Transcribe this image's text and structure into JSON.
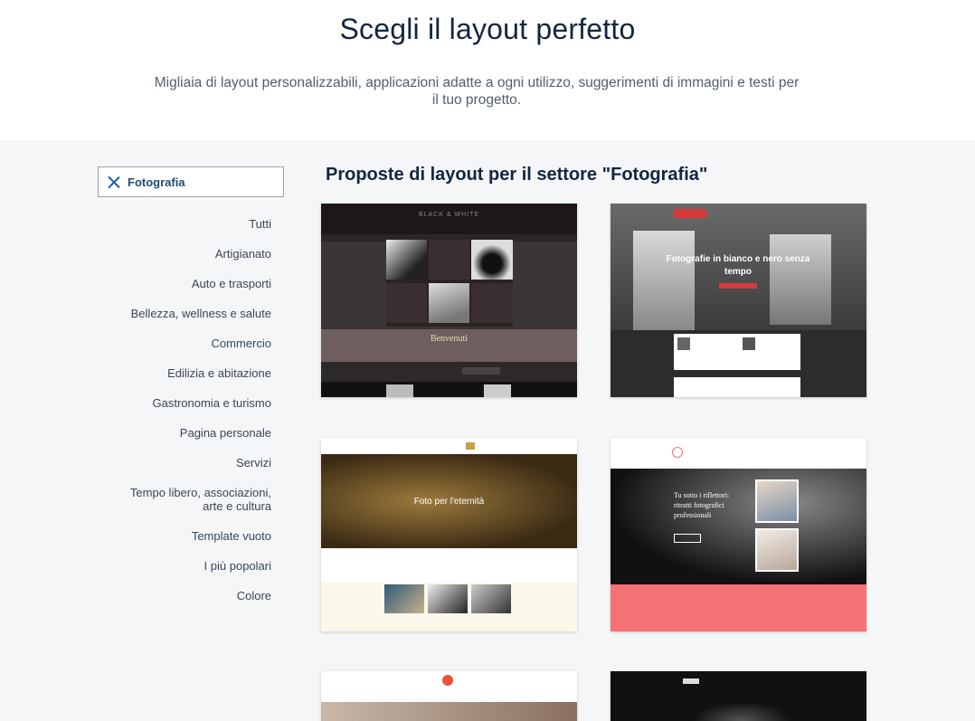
{
  "hero": {
    "title": "Scegli il layout perfetto",
    "subtitle": "Migliaia di layout personalizzabili, applicazioni adatte a ogni utilizzo, suggerimenti di immagini e testi per il tuo progetto."
  },
  "filter": {
    "active_label": "Fotografia",
    "clear_icon": "close-icon"
  },
  "sidebar": {
    "categories": [
      "Tutti",
      "Artigianato",
      "Auto e trasporti",
      "Bellezza, wellness e salute",
      "Commercio",
      "Edilizia e abitazione",
      "Gastronomia e turismo",
      "Pagina personale",
      "Servizi",
      "Tempo libero, associazioni,",
      "arte e cultura",
      "Template vuoto",
      "I più popolari",
      "Colore"
    ]
  },
  "main": {
    "title": "Proposte di layout per il settore \"Fotografia\"",
    "templates": [
      {
        "header": "BLACK & WHITE",
        "banner": "Benvenuti"
      },
      {
        "headline": "Fotografie in bianco e nero senza tempo"
      },
      {
        "headline": "Foto per l'eternità"
      },
      {
        "headline": "Tu sotto i riflettori: ritratti fotografici professionali"
      }
    ]
  },
  "colors": {
    "accent": "#1f5ea8",
    "coral": "#f47174",
    "hero_bg": "#ffffff",
    "page_bg": "#f5f6f8"
  }
}
